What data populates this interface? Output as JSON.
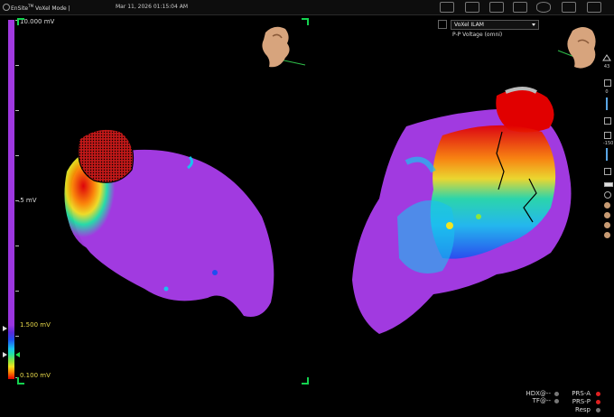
{
  "header": {
    "app_title": "EnSite",
    "app_title_sup": "TM",
    "app_mode": " VoXel Mode |",
    "timestamp": "Mar 11, 2026 01:15:04 AM"
  },
  "scale": {
    "max_label": "10.000 mV",
    "mid_label": ".5 mV",
    "upper_threshold_label": "1.500 mV",
    "lower_threshold_label": "0.100 mV",
    "colors": [
      "#a13ae0",
      "#1f4ff0",
      "#19c2ef",
      "#21e2a7",
      "#8de63c",
      "#f1e420",
      "#ff8a00",
      "#e10000"
    ]
  },
  "map_selector": {
    "selected": "VoXel ILAM",
    "caption": "P-P Voltage (omni)"
  },
  "side_tools": {
    "zoom_value": "43",
    "value_2": "0",
    "value_3": "-150"
  },
  "status": {
    "hdx": "HDX@--",
    "tf": "TF@--",
    "prs_a": "PRS-A",
    "prs_p": "PRS-P",
    "resp": "Resp",
    "prs_a_color": "#e02020",
    "prs_p_color": "#e02020",
    "resp_color": "#777777",
    "hdx_color": "#777777",
    "tf_color": "#777777"
  },
  "icons": [
    "app-logo-icon",
    "toolbar-icons",
    "map-type-icon",
    "orientation-head-icon"
  ]
}
